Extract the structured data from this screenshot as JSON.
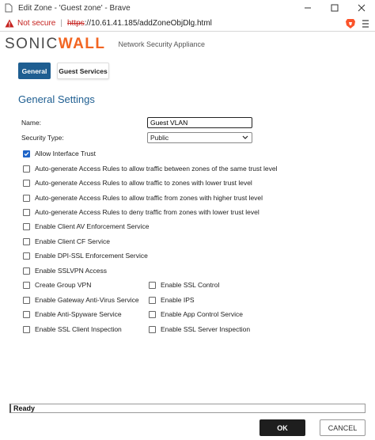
{
  "window": {
    "title": "Edit Zone - 'Guest zone' - Brave"
  },
  "address_bar": {
    "security_label": "Not secure",
    "url_scheme": "https",
    "url_rest": "://10.61.41.185/addZoneObjDlg.html"
  },
  "header": {
    "logo_main": "SONIC",
    "logo_accent": "WALL",
    "subtitle": "Network Security Appliance"
  },
  "tabs": [
    {
      "label": "General",
      "active": true
    },
    {
      "label": "Guest Services",
      "active": false
    }
  ],
  "section_title": "General Settings",
  "form": {
    "name_label": "Name:",
    "name_value": "Guest VLAN",
    "security_type_label": "Security Type:",
    "security_type_value": "Public"
  },
  "checkboxes_full": [
    {
      "label": "Allow Interface Trust",
      "checked": true
    },
    {
      "label": "Auto-generate Access Rules to allow traffic between zones of the same trust level",
      "checked": false
    },
    {
      "label": "Auto-generate Access Rules to allow traffic to zones with lower trust level",
      "checked": false
    },
    {
      "label": "Auto-generate Access Rules to allow traffic from zones with higher trust level",
      "checked": false
    },
    {
      "label": "Auto-generate Access Rules to deny traffic from zones with lower trust level",
      "checked": false
    },
    {
      "label": "Enable Client AV Enforcement Service",
      "checked": false
    },
    {
      "label": "Enable Client CF Service",
      "checked": false
    },
    {
      "label": "Enable DPI-SSL Enforcement Service",
      "checked": false
    },
    {
      "label": "Enable SSLVPN Access",
      "checked": false
    }
  ],
  "checkboxes_left": [
    {
      "label": "Create Group VPN",
      "checked": false
    },
    {
      "label": "Enable Gateway Anti-Virus Service",
      "checked": false
    },
    {
      "label": "Enable Anti-Spyware Service",
      "checked": false
    },
    {
      "label": "Enable SSL Client Inspection",
      "checked": false
    }
  ],
  "checkboxes_right": [
    {
      "label": "Enable SSL Control",
      "checked": false
    },
    {
      "label": "Enable IPS",
      "checked": false
    },
    {
      "label": "Enable App Control Service",
      "checked": false
    },
    {
      "label": "Enable SSL Server Inspection",
      "checked": false
    }
  ],
  "status": "Ready",
  "buttons": {
    "ok": "OK",
    "cancel": "CANCEL"
  },
  "colors": {
    "accent": "#1e5e91",
    "logo_accent": "#f26522",
    "warning": "#c5221f"
  }
}
